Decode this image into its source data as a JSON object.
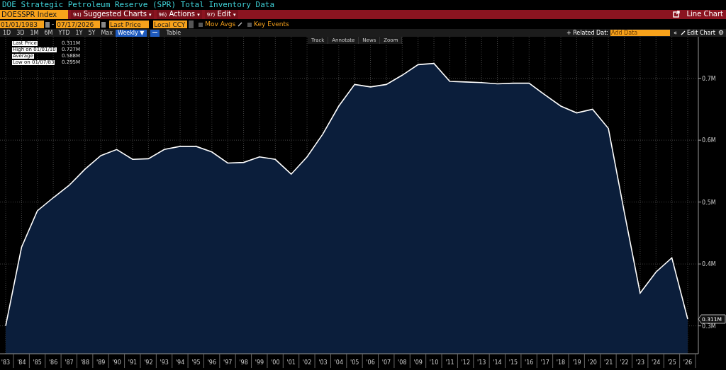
{
  "title": "DOE Strategic Petroleum Reserve (SPR) Total Inventory Data",
  "command_bar": {
    "ticker": "DOESSPR Index",
    "menus": [
      {
        "code": "94)",
        "label": "Suggested Charts",
        "caret": "▾"
      },
      {
        "code": "96)",
        "label": "Actions",
        "caret": "▾"
      },
      {
        "code": "97)",
        "label": "Edit",
        "caret": "▾"
      }
    ],
    "chart_type": "Line Chart"
  },
  "settings": {
    "start_date": "01/01/1983",
    "separator": "-",
    "end_date": "07/17/2026",
    "field": "Last Price",
    "currency": "Local CCY",
    "toggles": [
      {
        "label": "Mov Avgs",
        "checked": false
      },
      {
        "label": "Key Events",
        "checked": false
      }
    ]
  },
  "periods": [
    {
      "label": "1D",
      "selected": false
    },
    {
      "label": "3D",
      "selected": false
    },
    {
      "label": "1M",
      "selected": false
    },
    {
      "label": "6M",
      "selected": false
    },
    {
      "label": "YTD",
      "selected": false
    },
    {
      "label": "1Y",
      "selected": false
    },
    {
      "label": "5Y",
      "selected": false
    },
    {
      "label": "Max",
      "selected": false
    }
  ],
  "frequency": "Weekly ▼",
  "table_button": "Table",
  "related_data": "+ Related Dat:",
  "add_data_placeholder": "Add Data",
  "collapse": "«",
  "edit_chart": "Edit Chart",
  "chart_tools": [
    "Track",
    "Annotate",
    "News",
    "Zoom"
  ],
  "legend": [
    {
      "value": "0.311M"
    },
    {
      "label": "High on 01/01/10",
      "value": "0.727M"
    },
    {
      "label": "Average",
      "value": "0.588M"
    },
    {
      "label": "Low on 01/07/83",
      "value": "0.295M"
    }
  ],
  "last_flag": "0.311M",
  "settings_icon": "⚙",
  "chart_data": {
    "type": "area",
    "grid": true,
    "categories": [
      "'83",
      "'84",
      "'85",
      "'86",
      "'87",
      "'88",
      "'89",
      "'90",
      "'91",
      "'92",
      "'93",
      "'94",
      "'95",
      "'96",
      "'97",
      "'98",
      "'99",
      "'00",
      "'01",
      "'02",
      "'03",
      "'04",
      "'05",
      "'06",
      "'07",
      "'08",
      "'09",
      "'10",
      "'11",
      "'12",
      "'13",
      "'14",
      "'15",
      "'16",
      "'17",
      "'18",
      "'19",
      "'20",
      "'21",
      "'22",
      "'23",
      "'24",
      "'25",
      "'26"
    ],
    "ylim": [
      0.255,
      0.767
    ],
    "yticks": [
      {
        "value": 0.3,
        "label": "0.3M"
      },
      {
        "value": 0.4,
        "label": "0.4M"
      },
      {
        "value": 0.5,
        "label": "0.5M"
      },
      {
        "value": 0.6,
        "label": "0.6M"
      },
      {
        "value": 0.7,
        "label": "0.7M"
      }
    ],
    "series": [
      {
        "name": "Last Price",
        "color": "#ffffff",
        "values": [
          0.3,
          0.427,
          0.486,
          0.507,
          0.527,
          0.553,
          0.575,
          0.585,
          0.569,
          0.57,
          0.585,
          0.59,
          0.59,
          0.581,
          0.563,
          0.564,
          0.573,
          0.569,
          0.545,
          0.573,
          0.61,
          0.655,
          0.69,
          0.686,
          0.69,
          0.705,
          0.722,
          0.724,
          0.695,
          0.694,
          0.693,
          0.691,
          0.692,
          0.692,
          0.673,
          0.655,
          0.644,
          0.65,
          0.619,
          0.484,
          0.353,
          0.387,
          0.41,
          0.311
        ]
      }
    ]
  }
}
